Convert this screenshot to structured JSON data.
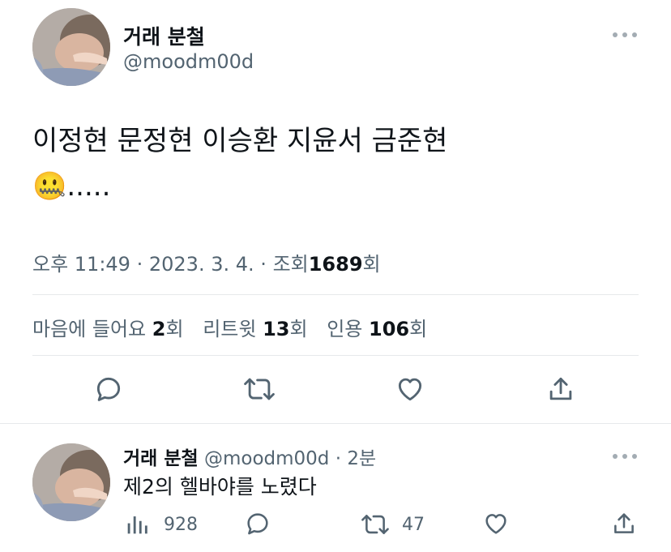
{
  "tweet": {
    "author_name": "거래 분철",
    "author_handle": "@moodm00d",
    "text_line1": "이정현 문정현 이승환 지윤서 금준현",
    "text_line2": "🤐.....",
    "time": "오후 11:49",
    "sep1": "·",
    "date": "2023. 3. 4.",
    "sep2": "·",
    "views_label": "조회",
    "views_count": "1689",
    "views_suffix": "회",
    "likes_label": "마음에 들어요",
    "likes_count": "2",
    "likes_suffix": "회",
    "retweets_label": "리트윗",
    "retweets_count": "13",
    "retweets_suffix": "회",
    "quotes_label": "인용",
    "quotes_count": "106",
    "quotes_suffix": "회"
  },
  "reply": {
    "author_name": "거래 분철",
    "author_handle": "@moodm00d",
    "sep": "·",
    "time_ago": "2분",
    "text": "제2의 헬바야를 노렸다",
    "views": "928",
    "retweets": "47"
  },
  "colors": {
    "text": "#0f1419",
    "secondary": "#536471",
    "icon": "#536471",
    "divider": "#e6e9eb"
  },
  "icons": {
    "more": "more-dots-icon",
    "reply": "reply-icon",
    "retweet": "retweet-icon",
    "like": "heart-icon",
    "share": "share-icon",
    "views": "views-icon"
  }
}
